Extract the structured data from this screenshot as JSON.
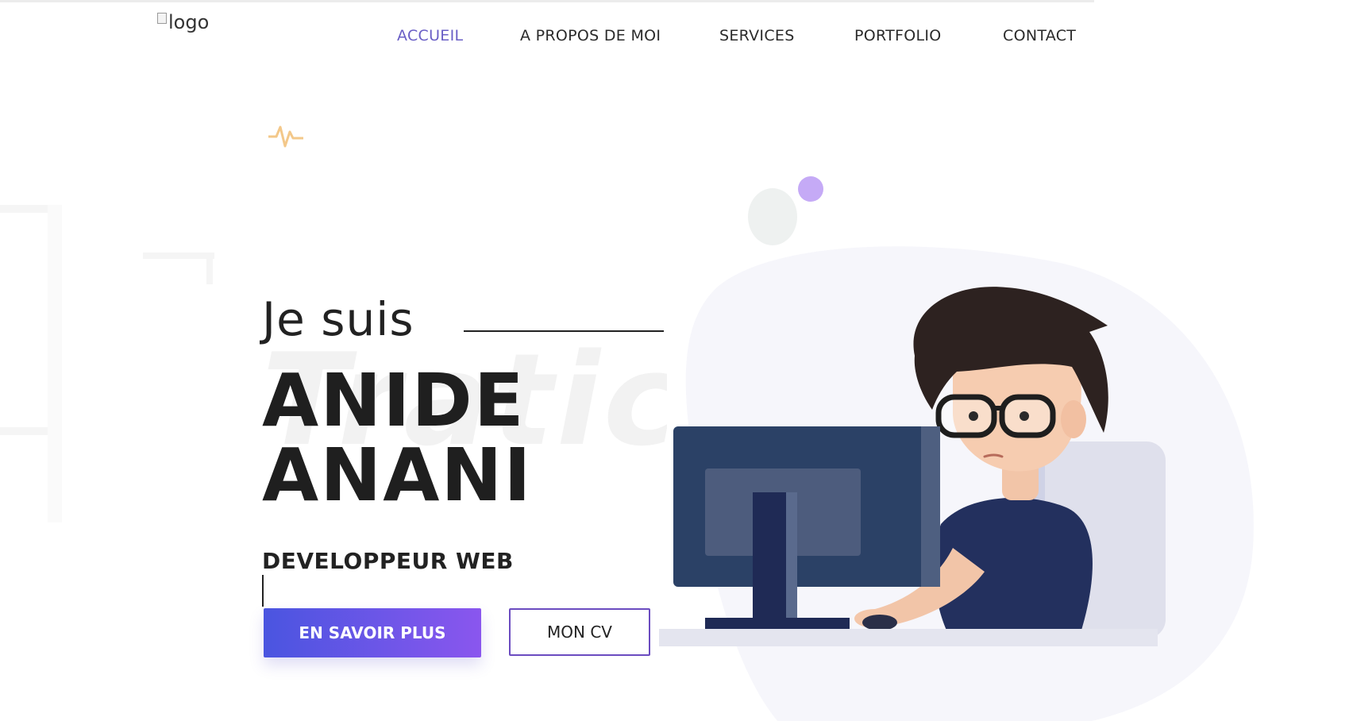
{
  "header": {
    "logo_alt": "logo",
    "nav": [
      {
        "label": "ACCUEIL",
        "active": true
      },
      {
        "label": "A PROPOS DE MOI",
        "active": false
      },
      {
        "label": "SERVICES",
        "active": false
      },
      {
        "label": "PORTFOLIO",
        "active": false
      },
      {
        "label": "CONTACT",
        "active": false
      }
    ]
  },
  "hero": {
    "intro": "Je suis",
    "name_line_1": "ANIDE",
    "name_line_2": "ANANI",
    "role": "DEVELOPPEUR WEB",
    "primary_button": "EN SAVOIR PLUS",
    "secondary_button": "MON CV"
  },
  "colors": {
    "accent": "#6a5fc6",
    "button_gradient_start": "#4a55e0",
    "button_gradient_end": "#8a56ee",
    "outline_border": "#6b4cc0",
    "monitor": "#2b4166",
    "shirt": "#23305e",
    "hair": "#2d2220",
    "blob": "#f6f6fb"
  },
  "icons": {
    "logo": "broken-image-icon",
    "decoration": "pulse-icon"
  }
}
